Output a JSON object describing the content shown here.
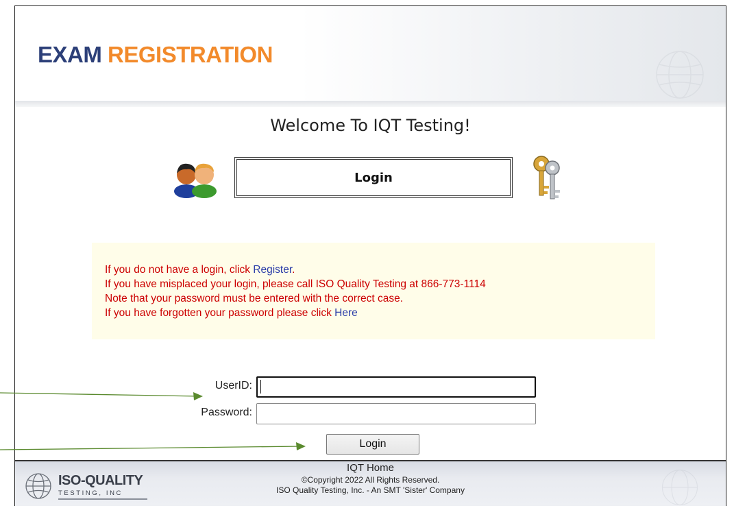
{
  "header": {
    "title_part1": "EXAM",
    "title_part2": "REGISTRATION"
  },
  "welcome": "Welcome To IQT Testing!",
  "login_panel": {
    "label": "Login"
  },
  "info": {
    "line1_prefix": "If you do not have a login, click ",
    "line1_link": "Register",
    "line1_suffix": ".",
    "line2": "If you have misplaced your login, please call ISO Quality Testing at 866-773-1114",
    "line3": "Note that your password must be entered with the correct case.",
    "line4_prefix": "If you have forgotten your password please click  ",
    "line4_link": "Here"
  },
  "form": {
    "userid_label": "UserID:",
    "userid_value": "",
    "password_label": "Password:",
    "password_value": "",
    "login_button": "Login"
  },
  "footer": {
    "logo_name": "ISO-QUALITY",
    "logo_sub": "TESTING, INC",
    "home_link": "IQT Home",
    "copyright": "©Copyright 2022 All Rights Reserved.",
    "company": "ISO Quality Testing, Inc. - An SMT 'Sister' Company"
  },
  "colors": {
    "title_blue": "#2c3f78",
    "title_orange": "#f28a2b",
    "info_red": "#cc0000",
    "link_blue": "#2a3ca8",
    "info_bg": "#fffde9",
    "arrow_green": "#5a8a2e"
  },
  "icons": [
    "people-icon",
    "keys-icon",
    "globe-icon",
    "arrow-icon"
  ]
}
